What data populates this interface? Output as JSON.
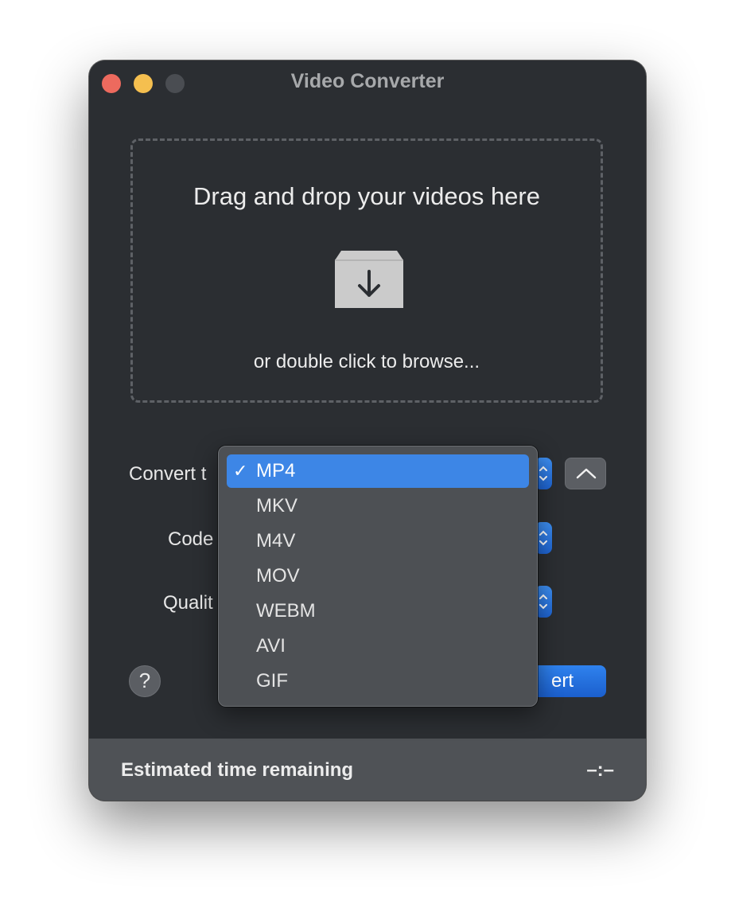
{
  "window": {
    "title": "Video Converter"
  },
  "dropzone": {
    "heading": "Drag and drop your videos here",
    "subtext": "or double click to browse..."
  },
  "form": {
    "convert_label": "Convert t",
    "codec_label": "Code",
    "quality_label": "Qualit"
  },
  "buttons": {
    "help": "?",
    "convert": "ert"
  },
  "footer": {
    "label": "Estimated time remaining",
    "value": "–:–"
  },
  "format_menu": {
    "check_mark": "✓",
    "selected": "MP4",
    "options": [
      "MP4",
      "MKV",
      "M4V",
      "MOV",
      "WEBM",
      "AVI",
      "GIF"
    ]
  },
  "colors": {
    "window_bg": "#2b2e32",
    "accent": "#3d86e6",
    "close": "#ed6a5e",
    "minimize": "#f5bf4f"
  }
}
